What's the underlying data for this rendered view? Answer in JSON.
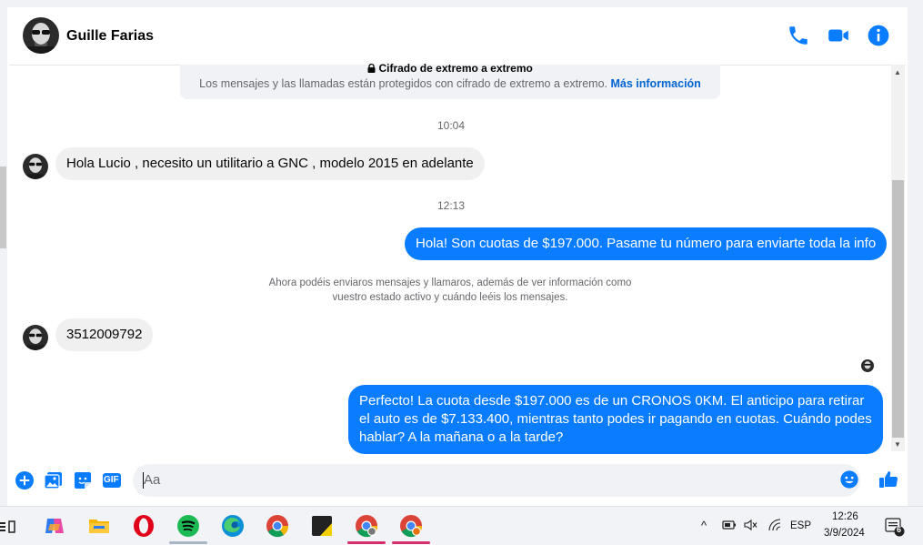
{
  "header": {
    "contact_name": "Guille Farias"
  },
  "encryption": {
    "title": "Cifrado de extremo a extremo",
    "description": "Los mensajes y las llamadas están protegidos con cifrado de extremo a extremo.",
    "link_label": "Más información"
  },
  "timestamps": [
    "10:04",
    "12:13"
  ],
  "messages": [
    {
      "direction": "incoming",
      "text": "Hola Lucio , necesito un utilitario a GNC  , modelo 2015 en adelante"
    },
    {
      "direction": "outgoing",
      "text": "Hola! Son cuotas de $197.000. Pasame tu número para enviarte toda la info"
    },
    {
      "direction": "incoming",
      "text": "3512009792"
    },
    {
      "direction": "outgoing",
      "text": "Perfecto! La cuota desde $197.000 es de un CRONOS 0KM. El anticipo para retirar el auto es de $7.133.400, mientras tanto podes ir pagando en cuotas. Cuándo podes hablar? A la mañana o a la tarde?"
    }
  ],
  "notice": {
    "line1": "Ahora podéis enviaros mensajes y llamaros, además de ver información como",
    "line2": "vuestro estado activo y cuándo leéis los mensajes."
  },
  "composer": {
    "placeholder": "Aa",
    "gif_label": "GIF"
  },
  "taskbar": {
    "language": "ESP",
    "time": "12:26",
    "date": "3/9/2024",
    "notification_count": "6"
  },
  "colors": {
    "accent": "#0a7cff",
    "incoming_bubble": "#f0f0f0",
    "secondary_text": "#65676b",
    "link": "#0064d1"
  },
  "icons": [
    "phone-icon",
    "video-icon",
    "info-icon",
    "lock-icon",
    "plus-icon",
    "image-icon",
    "sticker-icon",
    "gif-icon",
    "emoji-icon",
    "thumbs-up-icon"
  ]
}
